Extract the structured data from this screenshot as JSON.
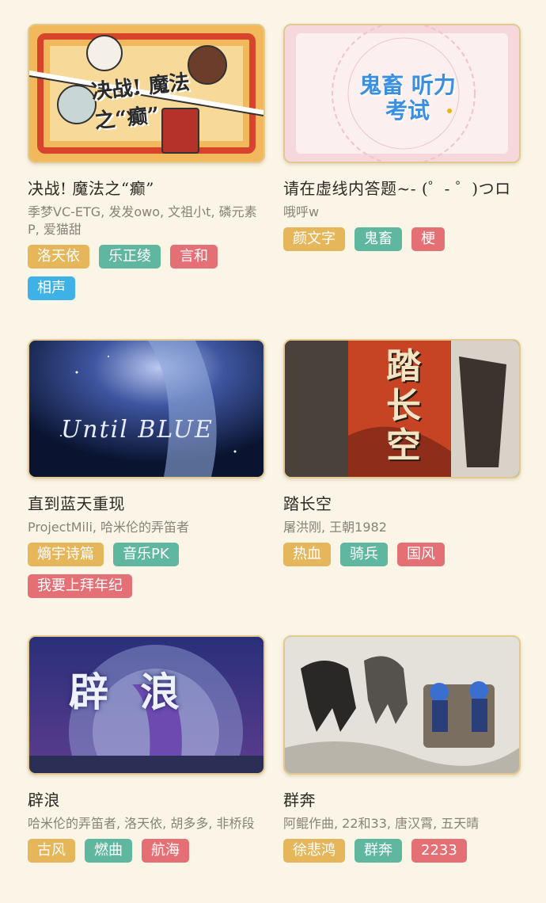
{
  "colors": {
    "tag_gold": "#e5b65a",
    "tag_teal": "#5fb7a0",
    "tag_red": "#e46f74",
    "tag_blue": "#3eb2e6"
  },
  "cards": [
    {
      "title": "决战! 魔法之“癫”",
      "authors": "季梦VC-ETG, 发发owo, 文祖小t, 磷元素P, 爱猫甜",
      "thumb_caption": "决战! 魔法之“癫”",
      "tags": [
        {
          "label": "洛天依",
          "color": "#e5b65a"
        },
        {
          "label": "乐正绫",
          "color": "#5fb7a0"
        },
        {
          "label": "言和",
          "color": "#e46f74"
        },
        {
          "label": "相声",
          "color": "#3eb2e6"
        }
      ]
    },
    {
      "title": "请在虚线内答题~- (゜- ゜)つロ",
      "authors": "哦呼w",
      "thumb_caption": "鬼畜 听力考试",
      "tags": [
        {
          "label": "颜文字",
          "color": "#e5b65a"
        },
        {
          "label": "鬼畜",
          "color": "#5fb7a0"
        },
        {
          "label": "梗",
          "color": "#e46f74"
        }
      ]
    },
    {
      "title": "直到蓝天重现",
      "authors": "ProjectMili, 哈米伦的弄笛者",
      "thumb_caption": "Until BLUE",
      "tags": [
        {
          "label": "熵宇诗篇",
          "color": "#e5b65a"
        },
        {
          "label": "音乐PK",
          "color": "#5fb7a0"
        },
        {
          "label": "我要上拜年纪",
          "color": "#e46f74"
        }
      ]
    },
    {
      "title": "踏长空",
      "authors": "屠洪刚, 王朝1982",
      "thumb_caption": "踏长空",
      "tags": [
        {
          "label": "热血",
          "color": "#e5b65a"
        },
        {
          "label": "骑兵",
          "color": "#5fb7a0"
        },
        {
          "label": "国风",
          "color": "#e46f74"
        }
      ]
    },
    {
      "title": "辟浪",
      "authors": "哈米伦的弄笛者, 洛天依, 胡多多, 非桥段",
      "thumb_caption": "辟浪",
      "tags": [
        {
          "label": "古风",
          "color": "#e5b65a"
        },
        {
          "label": "燃曲",
          "color": "#5fb7a0"
        },
        {
          "label": "航海",
          "color": "#e46f74"
        }
      ]
    },
    {
      "title": "群奔",
      "authors": "阿鲲作曲, 22和33, 唐汉霄, 五天晴",
      "thumb_caption": "",
      "tags": [
        {
          "label": "徐悲鸿",
          "color": "#e5b65a"
        },
        {
          "label": "群奔",
          "color": "#5fb7a0"
        },
        {
          "label": "2233",
          "color": "#e46f74"
        }
      ]
    }
  ]
}
